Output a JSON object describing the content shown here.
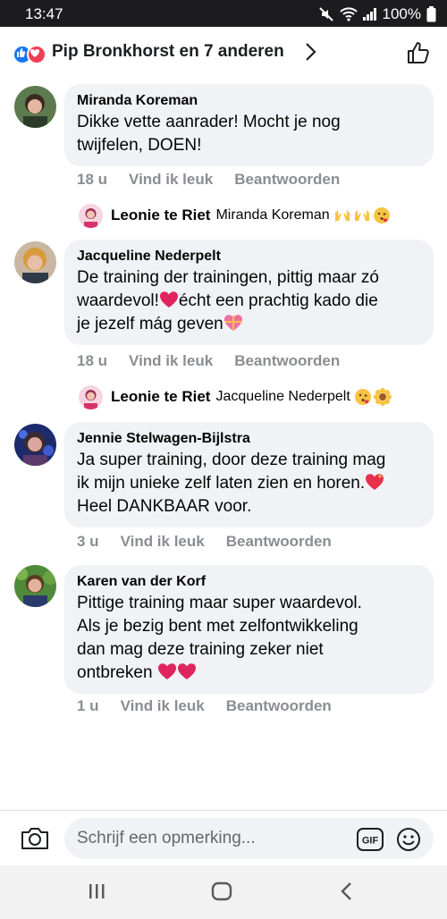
{
  "status": {
    "time": "13:47",
    "battery": "100%"
  },
  "header": {
    "title": "Pip Bronkhorst en 7 anderen"
  },
  "comments": [
    {
      "name": "Miranda Koreman",
      "lines": [
        "Dikke vette aanrader! Mocht je nog",
        "twijfelen, DOEN!"
      ],
      "time": "18 u",
      "like": "Vind ik leuk",
      "reply": "Beantwoorden",
      "replyEntry": {
        "name": "Leonie te Riet",
        "text": "Miranda Koreman"
      }
    },
    {
      "name": "Jacqueline Nederpelt",
      "lines": [
        "De training der trainingen, pittig maar zó",
        "waardevol!",
        "écht een prachtig kado die",
        "je jezelf mág geven"
      ],
      "time": "18 u",
      "like": "Vind ik leuk",
      "reply": "Beantwoorden",
      "replyEntry": {
        "name": "Leonie te Riet",
        "text": "Jacqueline Nederpelt"
      }
    },
    {
      "name": "Jennie Stelwagen-Bijlstra",
      "lines": [
        "Ja super training, door deze training mag",
        "ik mijn unieke zelf laten zien en horen.",
        "Heel DANKBAAR voor."
      ],
      "time": "3 u",
      "like": "Vind ik leuk",
      "reply": "Beantwoorden"
    },
    {
      "name": "Karen van der Korf",
      "lines": [
        "Pittige training maar super waardevol.",
        "Als je bezig bent met zelfontwikkeling",
        "dan mag deze training zeker niet",
        "ontbreken"
      ],
      "time": "1 u",
      "like": "Vind ik leuk",
      "reply": "Beantwoorden"
    }
  ],
  "composer": {
    "placeholder": "Schrijf een opmerking...",
    "gif": "GIF"
  }
}
